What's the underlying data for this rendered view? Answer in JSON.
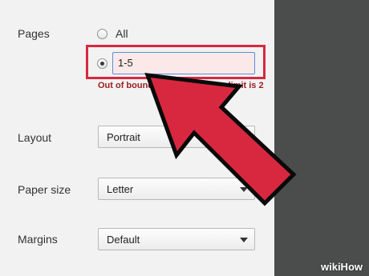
{
  "print_settings": {
    "pages": {
      "label": "Pages",
      "option_all": "All",
      "range_value": "1-5",
      "error_message": "Out of bounds page reference, limit is 2"
    },
    "layout": {
      "label": "Layout",
      "value": "Portrait"
    },
    "paper_size": {
      "label": "Paper size",
      "value": "Letter"
    },
    "margins": {
      "label": "Margins",
      "value": "Default"
    }
  },
  "watermark": {
    "text": "wikiHow"
  },
  "colors": {
    "highlight": "#d8283f",
    "arrow_fill": "#d8283f",
    "preview_pane": "#4b4c4c",
    "error_text": "#9b1c1c"
  },
  "icons": [
    "radio-unselected-icon",
    "radio-selected-icon",
    "dropdown-caret-icon",
    "pointer-arrow-icon"
  ]
}
